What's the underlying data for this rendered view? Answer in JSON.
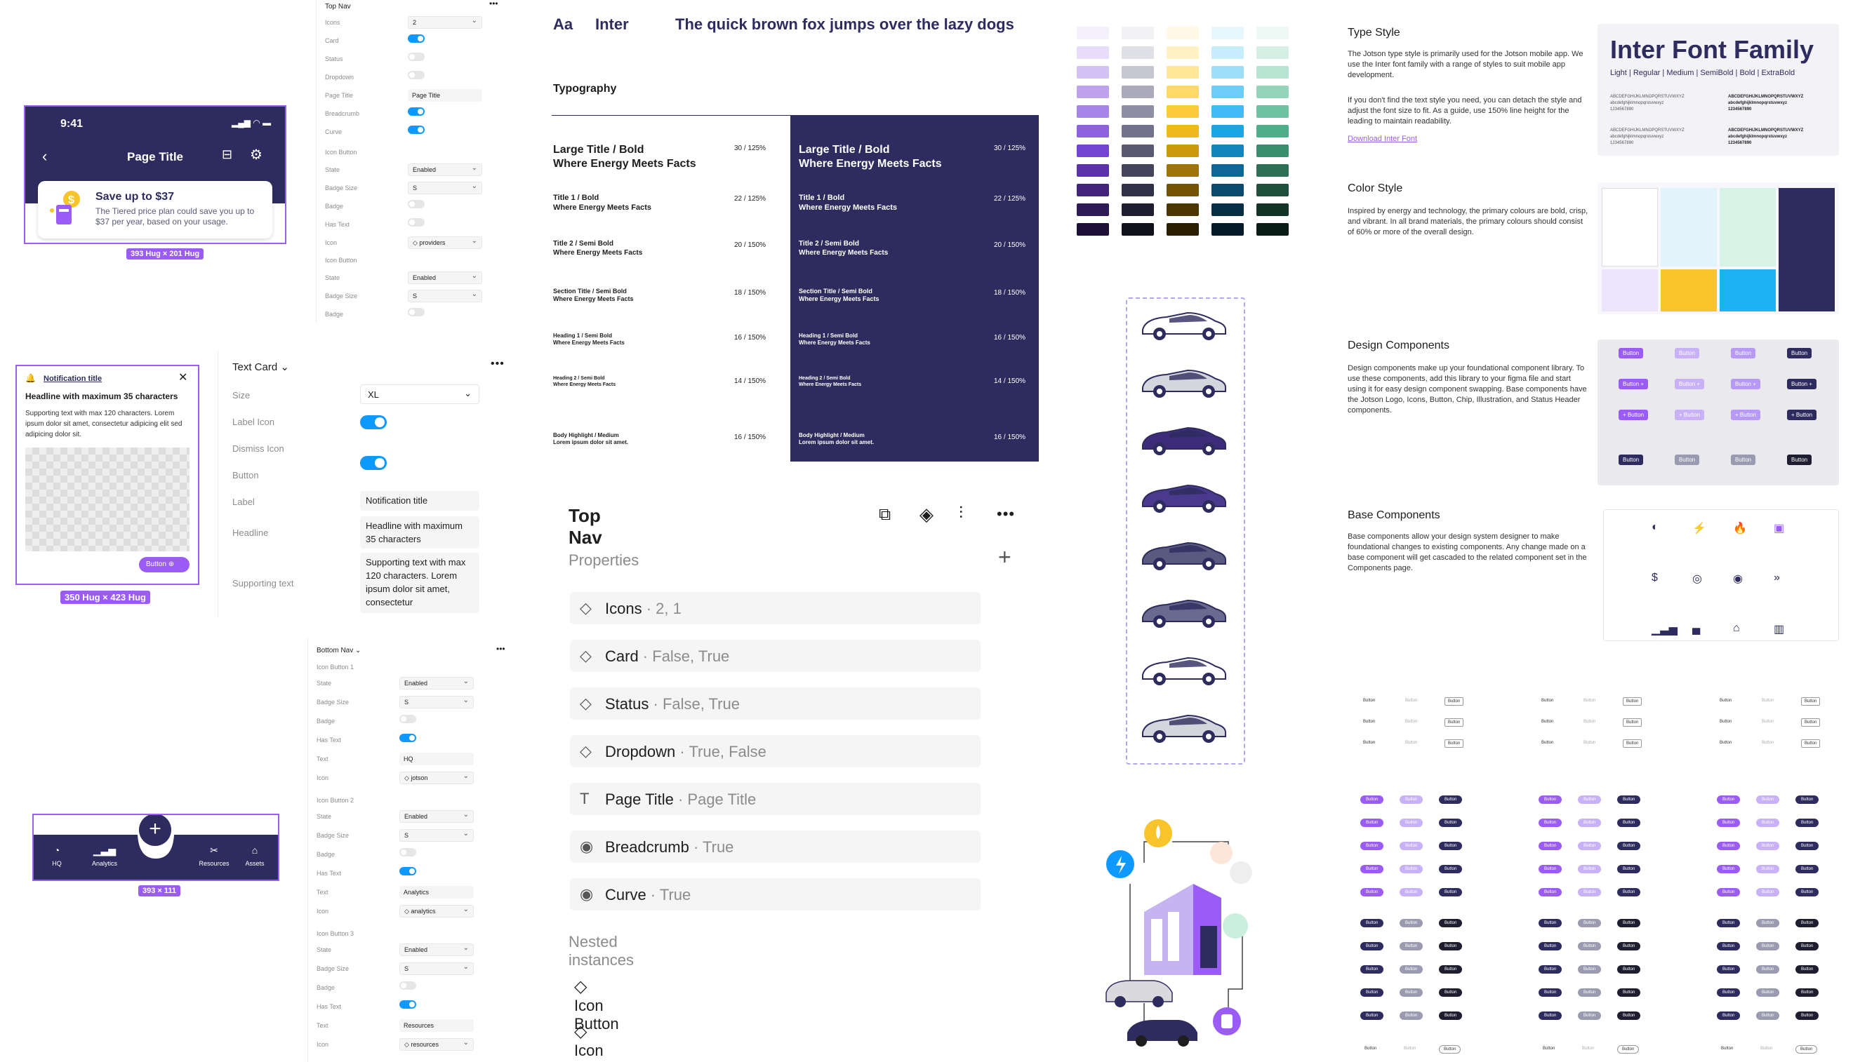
{
  "phone_mock": {
    "time": "9:41",
    "page_title": "Page Title",
    "card_title": "Save up to $37",
    "card_body": "The Tiered price plan could save you up to $37 per year, based on your usage.",
    "size_tag": "393 Hug × 201 Hug"
  },
  "top_nav_panel": {
    "title": "Top Nav",
    "rows": [
      {
        "label": "Icons",
        "type": "select",
        "value": "2"
      },
      {
        "label": "Card",
        "type": "toggle",
        "on": true
      },
      {
        "label": "Status",
        "type": "toggle",
        "on": false
      },
      {
        "label": "Dropdown",
        "type": "toggle",
        "on": false
      },
      {
        "label": "Page Title",
        "type": "input",
        "value": "Page Title"
      },
      {
        "label": "Breadcrumb",
        "type": "toggle",
        "on": true
      },
      {
        "label": "Curve",
        "type": "toggle",
        "on": true
      }
    ],
    "icon_button_1": {
      "title": "Icon Button",
      "state_label": "State",
      "state": "Enabled",
      "badge_size_label": "Badge Size",
      "badge_size": "S",
      "badge_label": "Badge",
      "has_text_label": "Has Text",
      "icon_label": "Icon",
      "icon": "providers"
    },
    "icon_button_2": {
      "title": "Icon Button",
      "state_label": "State",
      "state": "Enabled",
      "badge_size_label": "Badge Size",
      "badge_size": "S",
      "badge_label": "Badge"
    }
  },
  "notification_card": {
    "title": "Notification title",
    "headline": "Headline with maximum 35 characters",
    "supporting": "Supporting text with max 120 characters. Lorem ipsum dolor sit amet, consectetur adipicing elit sed adipicing dolor sit.",
    "button": "Button",
    "size_tag": "350 Hug × 423 Hug"
  },
  "text_card_panel": {
    "title": "Text Card",
    "size_label": "Size",
    "size": "XL",
    "label_icon_label": "Label Icon",
    "dismiss_icon_label": "Dismiss Icon",
    "button_label": "Button",
    "label_label": "Label",
    "label_value": "Notification title",
    "headline_label": "Headline",
    "headline_value": "Headline with maximum 35 characters",
    "supporting_label": "Supporting text",
    "supporting_value": "Supporting text with max 120 characters. Lorem ipsum dolor sit amet, consectetur"
  },
  "bottom_nav_mock": {
    "items": [
      "HQ",
      "Analytics",
      "Resources",
      "Assets"
    ],
    "size_tag": "393 × 111"
  },
  "bottom_nav_panel": {
    "title": "Bottom Nav",
    "groups": [
      {
        "title": "Icon Button 1",
        "state": "Enabled",
        "badge_size": "S",
        "text": "HQ",
        "icon": "jotson"
      },
      {
        "title": "Icon Button 2",
        "state": "Enabled",
        "badge_size": "S",
        "text": "Analytics",
        "icon": "analytics"
      },
      {
        "title": "Icon Button 3",
        "state": "Enabled",
        "badge_size": "S",
        "text": "Resources",
        "icon": "resources"
      }
    ],
    "labels": {
      "state": "State",
      "badge_size": "Badge Size",
      "badge": "Badge",
      "has_text": "Has Text",
      "text": "Text",
      "icon": "Icon"
    }
  },
  "typography": {
    "aa": "Aa",
    "font": "Inter",
    "sample": "The quick brown fox jumps over the lazy dogs",
    "heading": "Typography",
    "rows": [
      {
        "name": "Large Title / Bold",
        "sample": "Where Energy Meets Facts",
        "spec": "30 / 125%"
      },
      {
        "name": "Title 1 / Bold",
        "sample": "Where Energy Meets Facts",
        "spec": "22 / 125%"
      },
      {
        "name": "Title 2 / Semi Bold",
        "sample": "Where Energy Meets Facts",
        "spec": "20 / 150%"
      },
      {
        "name": "Section Title / Semi Bold",
        "sample": "Where Energy Meets Facts",
        "spec": "18 / 150%"
      },
      {
        "name": "Heading 1 / Semi Bold",
        "sample": "Where Energy Meets Facts",
        "spec": "16 / 150%"
      },
      {
        "name": "Heading 2 / Semi Bold",
        "sample": "Where Energy Meets Facts",
        "spec": "14 / 150%"
      },
      {
        "name": "Body Highlight / Medium",
        "sample": "Lorem ipsum dolor sit amet.",
        "spec": "16 / 150%"
      }
    ]
  },
  "props_panel": {
    "title": "Top Nav",
    "properties_heading": "Properties",
    "rows": [
      {
        "icon": "variant-icon",
        "name": "Icons",
        "value": "2, 1"
      },
      {
        "icon": "variant-icon",
        "name": "Card",
        "value": "False, True"
      },
      {
        "icon": "variant-icon",
        "name": "Status",
        "value": "False, True"
      },
      {
        "icon": "variant-icon",
        "name": "Dropdown",
        "value": "True, False"
      },
      {
        "icon": "text-icon",
        "name": "Page Title",
        "value": "Page Title"
      },
      {
        "icon": "boolean-icon",
        "name": "Breadcrumb",
        "value": "True"
      },
      {
        "icon": "boolean-icon",
        "name": "Curve",
        "value": "True"
      }
    ],
    "nested_heading": "Nested instances",
    "nested": [
      "Icon Button",
      "Icon Button"
    ]
  },
  "docs": {
    "type_style": {
      "title": "Type Style",
      "p1": "The Jotson type style is primarily used for the Jotson mobile app. We use the Inter font family with a range of styles to suit mobile app development.",
      "p2": "If you don't find the text style you need, you can detach the style and adjust the font size to fit. As a guide, use 150% line height for the leading to maintain readability.",
      "link": "Download Inter Font"
    },
    "color_style": {
      "title": "Color Style",
      "p1": "Inspired by energy and technology, the primary colours are bold, crisp, and vibrant. In all brand materials, the primary colours should consist of 60% or more of the overall design."
    },
    "design_components": {
      "title": "Design Components",
      "p1": "Design components make up your foundational component library. To use these components, add this library to your figma file and start using it for easy design component swapping. Base components have the Jotson Logo, Icons, Button, Chip, Illustration, and Status Header components."
    },
    "base_components": {
      "title": "Base Components",
      "p1": "Base components allow your design system designer to make foundational changes to existing components. Any change made on a base component will get cascaded to the related component set in the Components page."
    }
  },
  "inter_card": {
    "title": "Inter Font Family",
    "weights": "Light | Regular | Medium | SemiBold | Bold | ExtraBold",
    "alpha_upper": "ABCDEFGHIJKLMNOPQRSTUVWXYZ",
    "alpha_lower": "abcdefghijklmnopqrstuvwxyz",
    "digits": "1234567890"
  },
  "button_label": "Button",
  "colors": {
    "navy": "#2e2c5e",
    "purple": "#9b5cf5",
    "figma_blue": "#0d99ff",
    "grey_bg": "#f5f5f5"
  }
}
